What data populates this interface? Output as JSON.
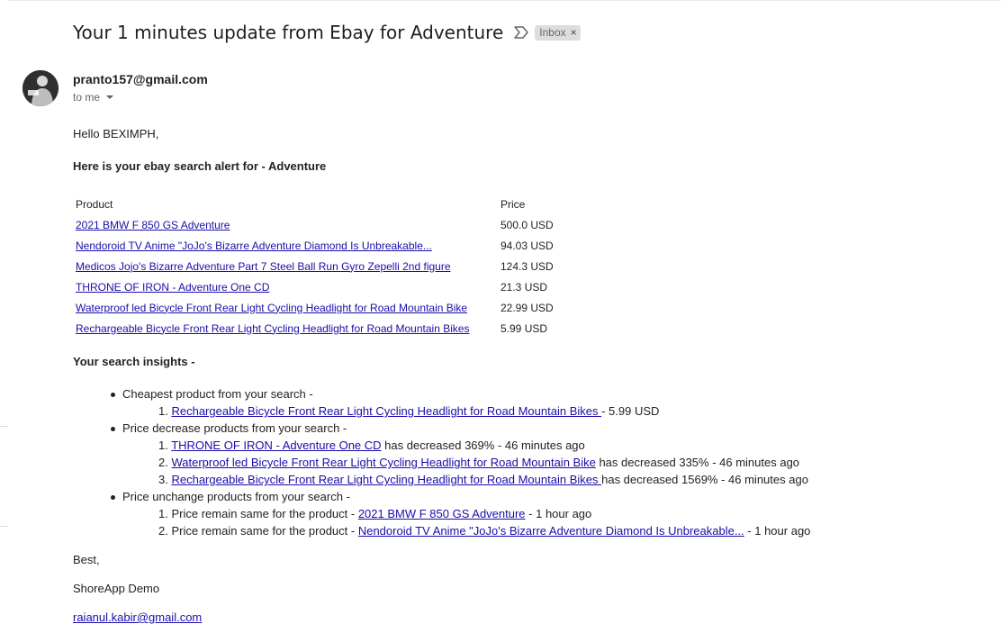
{
  "email": {
    "subject": "Your 1 minutes update from Ebay for Adventure",
    "label": "Inbox",
    "label_remove": "×",
    "sender": "pranto157@gmail.com",
    "to_label": "to me"
  },
  "content": {
    "greeting": "Hello BEXIMPH,",
    "alert_heading": "Here is your ebay search alert for - Adventure",
    "table": {
      "headers": [
        "Product",
        "Price"
      ],
      "rows": [
        {
          "product": "2021 BMW F 850 GS Adventure",
          "price": "500.0 USD"
        },
        {
          "product": "Nendoroid TV Anime \"JoJo's Bizarre Adventure Diamond Is Unbreakable...",
          "price": "94.03 USD"
        },
        {
          "product": "Medicos Jojo's Bizarre Adventure Part 7 Steel Ball Run Gyro Zepelli 2nd figure",
          "price": "124.3 USD"
        },
        {
          "product": "THRONE OF IRON - Adventure One CD",
          "price": "21.3 USD"
        },
        {
          "product": "Waterproof led Bicycle Front Rear Light Cycling Headlight for Road Mountain Bike",
          "price": "22.99 USD"
        },
        {
          "product": "Rechargeable Bicycle Front Rear Light Cycling Headlight for Road Mountain Bikes",
          "price": "5.99 USD"
        }
      ]
    },
    "insights_heading": "Your search insights -",
    "cheapest": {
      "label": "Cheapest product from your search -",
      "items": [
        {
          "num": "1.",
          "link": "Rechargeable Bicycle Front Rear Light Cycling Headlight for Road Mountain Bikes ",
          "suffix": " - 5.99 USD"
        }
      ]
    },
    "decrease": {
      "label": "Price decrease products from your search -",
      "items": [
        {
          "num": "1.",
          "link": "THRONE OF IRON - Adventure One CD",
          "suffix": " has decreased 369% - 46 minutes ago"
        },
        {
          "num": "2.",
          "link": "Waterproof led Bicycle Front Rear Light Cycling Headlight for Road Mountain Bike",
          "suffix": " has decreased 335% - 46 minutes ago"
        },
        {
          "num": "3.",
          "link": "Rechargeable Bicycle Front Rear Light Cycling Headlight for Road Mountain Bikes ",
          "suffix": "has decreased 1569% - 46 minutes ago"
        }
      ]
    },
    "unchange": {
      "label": "Price unchange products from your search -",
      "items": [
        {
          "num": "1.",
          "prefix": "Price remain same for the product - ",
          "link": "2021 BMW F 850 GS Adventure",
          "suffix": " - 1 hour ago"
        },
        {
          "num": "2.",
          "prefix": "Price remain same for the product - ",
          "link": "Nendoroid TV Anime \"JoJo's Bizarre Adventure Diamond Is Unbreakable...",
          "suffix": " - 1 hour ago"
        }
      ]
    },
    "signoff": "Best,",
    "company": "ShoreApp Demo",
    "contact_email": "raianul.kabir@gmail.com"
  }
}
